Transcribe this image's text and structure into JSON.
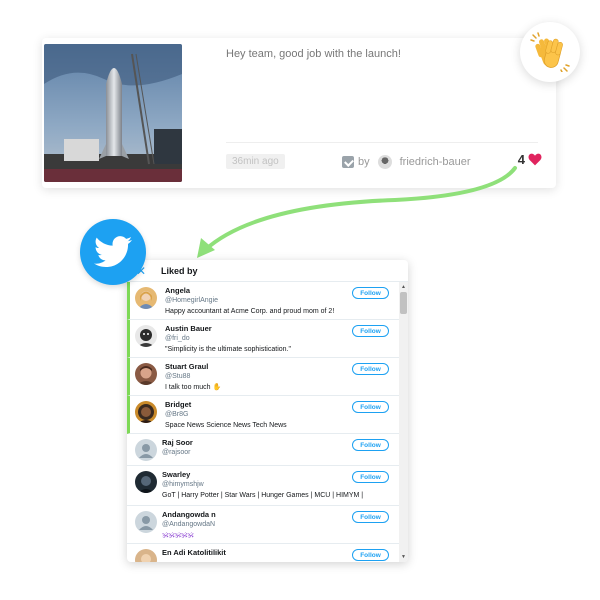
{
  "post": {
    "message": "Hey team, good job with the launch!",
    "time": "36min ago",
    "by_label": "by",
    "author": "friedrich-bauer",
    "likes": "4"
  },
  "panel": {
    "title": "Liked by",
    "close_glyph": "✕",
    "follow_label": "Follow"
  },
  "users": [
    {
      "name": "Angela",
      "handle": "@HomegirlAngie",
      "bio": "Happy accountant at Acme Corp. and proud mom of 2!"
    },
    {
      "name": "Austin Bauer",
      "handle": "@fri_do",
      "bio": "\"Simplicity is the ultimate sophistication.\""
    },
    {
      "name": "Stuart Graul",
      "handle": "@Stu88",
      "bio": "I talk too much ✋"
    },
    {
      "name": "Bridget",
      "handle": "@Br8G",
      "bio": "Space News Science News Tech News"
    },
    {
      "name": "Raj Soor",
      "handle": "@rajsoor",
      "bio": ""
    },
    {
      "name": "Swarley",
      "handle": "@himymshjw",
      "bio": "GoT | Harry Potter | Star Wars | Hunger Games | MCU | HIMYM |"
    },
    {
      "name": "Andangowda n",
      "handle": "@AndangowdaN",
      "bio": "🕉🕉🕉🕉🕉"
    },
    {
      "name": "En Adi Katolitilikit",
      "handle": "",
      "bio": ""
    }
  ],
  "colors": {
    "twitter_blue": "#1da1f2",
    "highlight_green": "#7ed957",
    "heart_red": "#e0245e"
  }
}
